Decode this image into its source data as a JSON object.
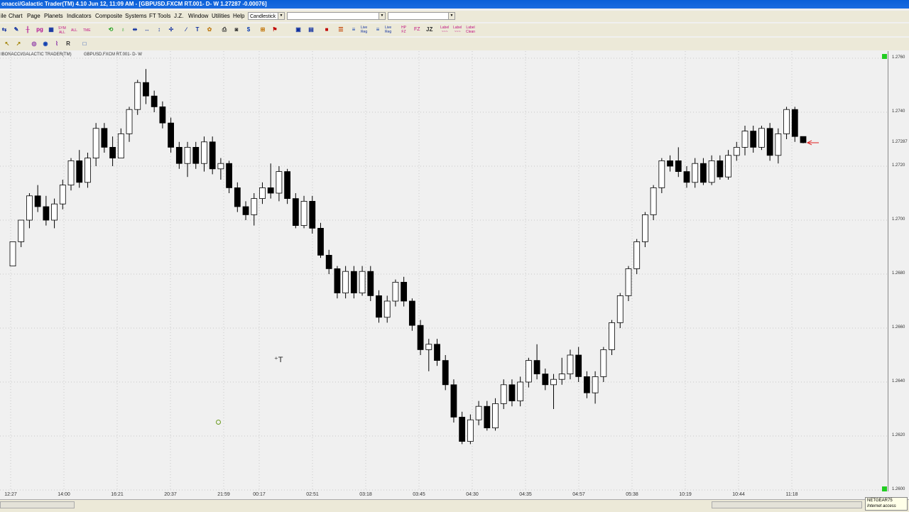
{
  "window": {
    "title": "onacci/Galactic Trader(TM) 4.10 Jun 12,  11:09 AM - [GBPUSD.FXCM RT.001- D- W 1.27287   -0.00076]"
  },
  "menu": {
    "items": [
      "ile",
      "Chart",
      "Page",
      "Planets",
      "Indicators",
      "Composite",
      "Systems",
      "FT Tools",
      "J.Z.",
      "Window",
      "Utilities",
      "Help"
    ],
    "chart_type": "Candlestick",
    "combo2": "",
    "combo3": ""
  },
  "toolbar": {
    "labels": {
      "sym_all": "SYM\nALL",
      "all_label": "ALL",
      "tme": "TME",
      "live_reg1": "Live\nReg",
      "live_reg2": "Live\nReg",
      "hpfz": "HP\nFZ",
      "fz": "FZ",
      "jz": "JZ",
      "label1": "Label\n~~~",
      "label2": "Label\n~~~",
      "label3": "Label\nClean"
    }
  },
  "chart": {
    "header_left": "IBONACCI/GALACTIC TRADER(TM)",
    "header_right": "GBPUSD.FXCM RT.001- D- W",
    "current_price_label": "1.27287",
    "colors": {
      "up": "#ffffff",
      "down": "#000000",
      "marker": "#e02020"
    }
  },
  "chart_data": {
    "type": "candlestick",
    "symbol": "GBPUSD.FXCM",
    "y_ticks": [
      1.276,
      1.274,
      1.272,
      1.27,
      1.268,
      1.266,
      1.264,
      1.262,
      1.26
    ],
    "y_tick_labels": [
      "1.2760",
      "1.2740",
      "1.2720",
      "1.2700",
      "1.2680",
      "1.2660",
      "1.2640",
      "1.2620",
      "1.2600"
    ],
    "ylim": [
      1.26,
      1.276
    ],
    "x_tick_labels": [
      "12:27",
      "14:00",
      "16:21",
      "20:37",
      "21:59",
      "00:17",
      "02:51",
      "03:18",
      "03:45",
      "04:30",
      "04:35",
      "04:57",
      "05:38",
      "10:19",
      "10:44",
      "11:18"
    ],
    "grid": true,
    "last_price": 1.27287,
    "change": -0.00076,
    "candles": [
      [
        1.2683,
        1.2692,
        1.2684,
        1.2683
      ],
      [
        1.2692,
        1.27,
        1.2692,
        1.269
      ],
      [
        1.27,
        1.2709,
        1.271,
        1.2697
      ],
      [
        1.2709,
        1.2705,
        1.2713,
        1.2703
      ],
      [
        1.2705,
        1.27,
        1.2709,
        1.2698
      ],
      [
        1.27,
        1.2706,
        1.2708,
        1.2697
      ],
      [
        1.2706,
        1.2713,
        1.2715,
        1.2704
      ],
      [
        1.2713,
        1.2722,
        1.2723,
        1.2711
      ],
      [
        1.2722,
        1.2714,
        1.2726,
        1.2712
      ],
      [
        1.2714,
        1.2723,
        1.2725,
        1.2712
      ],
      [
        1.2723,
        1.2734,
        1.2736,
        1.272
      ],
      [
        1.2734,
        1.2727,
        1.2736,
        1.2725
      ],
      [
        1.2727,
        1.2723,
        1.2731,
        1.272
      ],
      [
        1.2723,
        1.2732,
        1.2734,
        1.2727
      ],
      [
        1.2732,
        1.2741,
        1.2742,
        1.2729
      ],
      [
        1.2741,
        1.2751,
        1.2752,
        1.2739
      ],
      [
        1.2751,
        1.2746,
        1.2756,
        1.2743
      ],
      [
        1.2746,
        1.2742,
        1.2748,
        1.274
      ],
      [
        1.2742,
        1.2736,
        1.2744,
        1.2734
      ],
      [
        1.2736,
        1.2727,
        1.2738,
        1.2725
      ],
      [
        1.2727,
        1.2721,
        1.2729,
        1.2719
      ],
      [
        1.2721,
        1.2727,
        1.2729,
        1.2716
      ],
      [
        1.2727,
        1.2721,
        1.2729,
        1.2719
      ],
      [
        1.2721,
        1.2729,
        1.2731,
        1.2718
      ],
      [
        1.2729,
        1.2719,
        1.2731,
        1.2717
      ],
      [
        1.2719,
        1.2721,
        1.2723,
        1.2715
      ],
      [
        1.2721,
        1.2712,
        1.2722,
        1.271
      ],
      [
        1.2712,
        1.2705,
        1.2714,
        1.2703
      ],
      [
        1.2705,
        1.2702,
        1.2707,
        1.27
      ],
      [
        1.2702,
        1.2708,
        1.271,
        1.2698
      ],
      [
        1.2708,
        1.2712,
        1.2714,
        1.2706
      ],
      [
        1.2712,
        1.271,
        1.2721,
        1.2708
      ],
      [
        1.271,
        1.2718,
        1.272,
        1.2707
      ],
      [
        1.2718,
        1.2708,
        1.2719,
        1.2706
      ],
      [
        1.2708,
        1.2698,
        1.271,
        1.2697
      ],
      [
        1.2698,
        1.2707,
        1.2709,
        1.2697
      ],
      [
        1.2707,
        1.2697,
        1.2709,
        1.2695
      ],
      [
        1.2697,
        1.2687,
        1.2699,
        1.2686
      ],
      [
        1.2687,
        1.2682,
        1.2689,
        1.268
      ],
      [
        1.2682,
        1.2673,
        1.2683,
        1.2671
      ],
      [
        1.2673,
        1.2681,
        1.2683,
        1.2671
      ],
      [
        1.2681,
        1.2673,
        1.2683,
        1.2671
      ],
      [
        1.2673,
        1.2681,
        1.2683,
        1.2672
      ],
      [
        1.2681,
        1.2672,
        1.2683,
        1.267
      ],
      [
        1.2672,
        1.2664,
        1.2674,
        1.2662
      ],
      [
        1.2664,
        1.267,
        1.2672,
        1.2662
      ],
      [
        1.267,
        1.2677,
        1.2678,
        1.2668
      ],
      [
        1.2677,
        1.267,
        1.2679,
        1.2668
      ],
      [
        1.267,
        1.2661,
        1.2671,
        1.2659
      ],
      [
        1.2661,
        1.2652,
        1.2663,
        1.265
      ],
      [
        1.2652,
        1.2654,
        1.2656,
        1.2644
      ],
      [
        1.2654,
        1.2648,
        1.2656,
        1.2646
      ],
      [
        1.2648,
        1.2639,
        1.265,
        1.2637
      ],
      [
        1.2639,
        1.2627,
        1.2641,
        1.2625
      ],
      [
        1.2627,
        1.2618,
        1.2629,
        1.2617
      ],
      [
        1.2618,
        1.2626,
        1.2628,
        1.2617
      ],
      [
        1.2626,
        1.2631,
        1.2633,
        1.2624
      ],
      [
        1.2631,
        1.2623,
        1.2633,
        1.2622
      ],
      [
        1.2623,
        1.2632,
        1.2634,
        1.2622
      ],
      [
        1.2632,
        1.2639,
        1.2641,
        1.263
      ],
      [
        1.2639,
        1.2633,
        1.2641,
        1.2631
      ],
      [
        1.2633,
        1.264,
        1.2642,
        1.2631
      ],
      [
        1.264,
        1.2648,
        1.2649,
        1.2638
      ],
      [
        1.2648,
        1.2643,
        1.2654,
        1.2641
      ],
      [
        1.2643,
        1.2639,
        1.2645,
        1.2637
      ],
      [
        1.2639,
        1.2641,
        1.2643,
        1.263
      ],
      [
        1.2641,
        1.2643,
        1.2649,
        1.2639
      ],
      [
        1.2643,
        1.265,
        1.2652,
        1.2641
      ],
      [
        1.265,
        1.2642,
        1.2653,
        1.264
      ],
      [
        1.2642,
        1.2636,
        1.2644,
        1.2634
      ],
      [
        1.2636,
        1.2642,
        1.2644,
        1.2632
      ],
      [
        1.2642,
        1.2652,
        1.2653,
        1.264
      ],
      [
        1.2652,
        1.2662,
        1.2663,
        1.265
      ],
      [
        1.2662,
        1.2672,
        1.2673,
        1.266
      ],
      [
        1.2672,
        1.2682,
        1.2683,
        1.267
      ],
      [
        1.2682,
        1.2692,
        1.2693,
        1.268
      ],
      [
        1.2692,
        1.2702,
        1.2703,
        1.269
      ],
      [
        1.2702,
        1.2712,
        1.2713,
        1.27
      ],
      [
        1.2712,
        1.2722,
        1.2723,
        1.271
      ],
      [
        1.2722,
        1.272,
        1.2724,
        1.2718
      ],
      [
        1.2722,
        1.2718,
        1.2727,
        1.2716
      ],
      [
        1.2718,
        1.2714,
        1.272,
        1.2712
      ],
      [
        1.2714,
        1.2721,
        1.2723,
        1.2712
      ],
      [
        1.2721,
        1.2714,
        1.2723,
        1.2713
      ],
      [
        1.2714,
        1.2722,
        1.2724,
        1.2713
      ],
      [
        1.2722,
        1.2716,
        1.2724,
        1.2715
      ],
      [
        1.2716,
        1.2724,
        1.2726,
        1.2715
      ],
      [
        1.2724,
        1.2727,
        1.2729,
        1.2722
      ],
      [
        1.2727,
        1.2733,
        1.2735,
        1.2724
      ],
      [
        1.2733,
        1.2727,
        1.2735,
        1.2725
      ],
      [
        1.2727,
        1.2734,
        1.2735,
        1.2726
      ],
      [
        1.2734,
        1.2724,
        1.2736,
        1.2722
      ],
      [
        1.2724,
        1.2732,
        1.2734,
        1.2721
      ],
      [
        1.2732,
        1.2741,
        1.2742,
        1.273
      ],
      [
        1.2741,
        1.2731,
        1.2742,
        1.2729
      ],
      [
        1.2731,
        1.27287,
        1.2731,
        1.27285
      ]
    ]
  }
}
